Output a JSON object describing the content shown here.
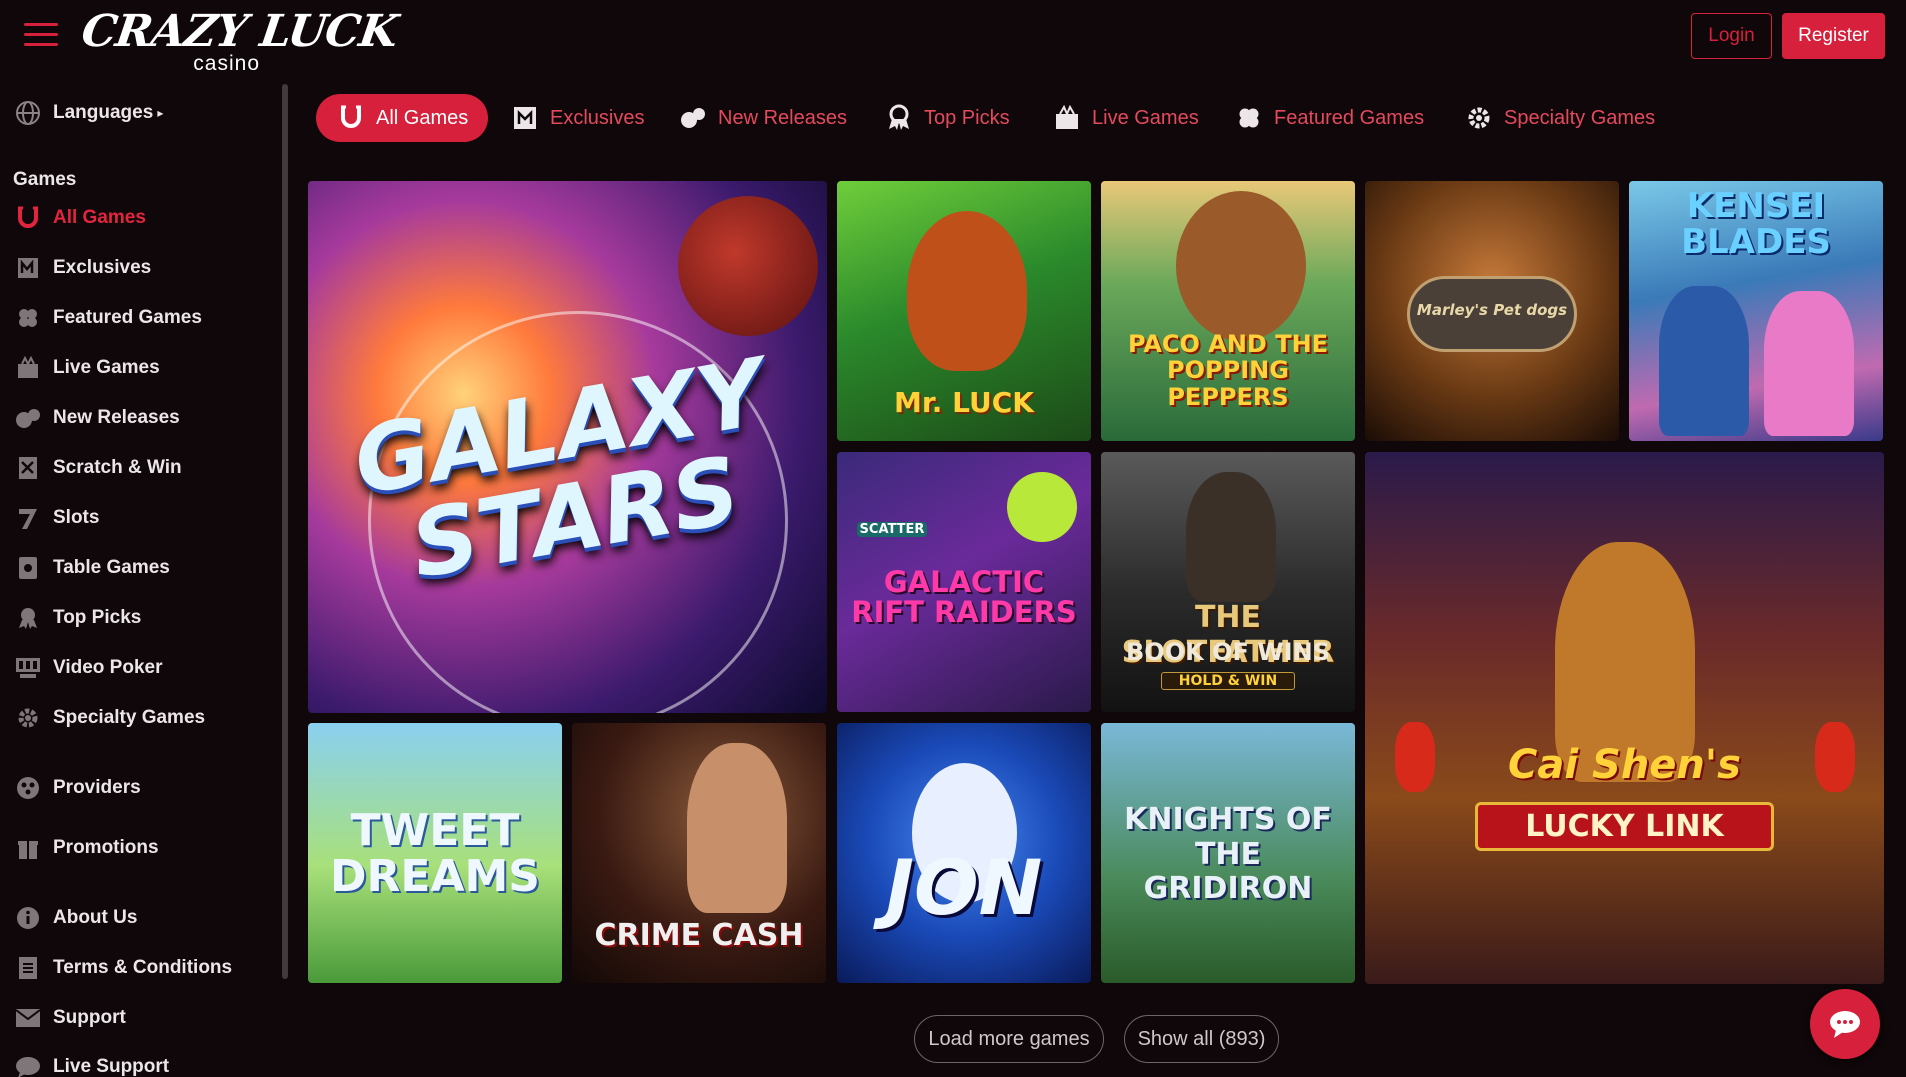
{
  "header": {
    "logo_brand": "CRAZY LUCK",
    "logo_sub": "casino",
    "login_label": "Login",
    "register_label": "Register"
  },
  "sidebar": {
    "languages_label": "Languages",
    "games_heading": "Games",
    "items": [
      {
        "label": "All Games",
        "icon": "horseshoe-icon",
        "active": true
      },
      {
        "label": "Exclusives",
        "icon": "exclusives-icon"
      },
      {
        "label": "Featured Games",
        "icon": "clover-icon"
      },
      {
        "label": "Live Games",
        "icon": "live-games-icon"
      },
      {
        "label": "New Releases",
        "icon": "new-releases-icon"
      },
      {
        "label": "Scratch & Win",
        "icon": "scratch-card-icon"
      },
      {
        "label": "Slots",
        "icon": "slot-seven-icon"
      },
      {
        "label": "Table Games",
        "icon": "table-card-icon"
      },
      {
        "label": "Top Picks",
        "icon": "award-icon"
      },
      {
        "label": "Video Poker",
        "icon": "video-poker-icon"
      },
      {
        "label": "Specialty Games",
        "icon": "gear-icon"
      }
    ],
    "providers_label": "Providers",
    "promotions_label": "Promotions",
    "about_label": "About Us",
    "terms_label": "Terms & Conditions",
    "support_label": "Support",
    "live_support_label": "Live Support"
  },
  "tabs": [
    {
      "label": "All Games",
      "icon": "horseshoe-icon",
      "active": true
    },
    {
      "label": "Exclusives",
      "icon": "exclusives-icon"
    },
    {
      "label": "New Releases",
      "icon": "new-releases-icon"
    },
    {
      "label": "Top Picks",
      "icon": "award-icon"
    },
    {
      "label": "Live Games",
      "icon": "live-games-icon"
    },
    {
      "label": "Featured Games",
      "icon": "clover-icon"
    },
    {
      "label": "Specialty Games",
      "icon": "gear-icon"
    }
  ],
  "games": [
    {
      "title": "GALAXY STARS"
    },
    {
      "title": "Mr. LUCK"
    },
    {
      "title": "PACO AND THE POPPING PEPPERS"
    },
    {
      "title": "Marley's Pet dogs"
    },
    {
      "title": "KENSEI BLADES"
    },
    {
      "title": "SCATTER",
      "subtitle": "GALACTIC RIFT RAIDERS"
    },
    {
      "title": "THE SLOTFATHER",
      "subtitle": "BOOK OF WINS",
      "tag": "HOLD & WIN"
    },
    {
      "title": "Cai Shen's",
      "subtitle": "LUCKY LINK"
    },
    {
      "title": "TWEET DREAMS"
    },
    {
      "title": "CRIME CASH"
    },
    {
      "title": "JON"
    },
    {
      "title": "KNIGHTS OF THE GRIDIRON"
    }
  ],
  "bottom": {
    "load_more_label": "Load more games",
    "show_all_label": "Show all (893)"
  },
  "colors": {
    "accent": "#d6203c",
    "background": "#0f0709",
    "tab_text": "#e44a5e"
  }
}
